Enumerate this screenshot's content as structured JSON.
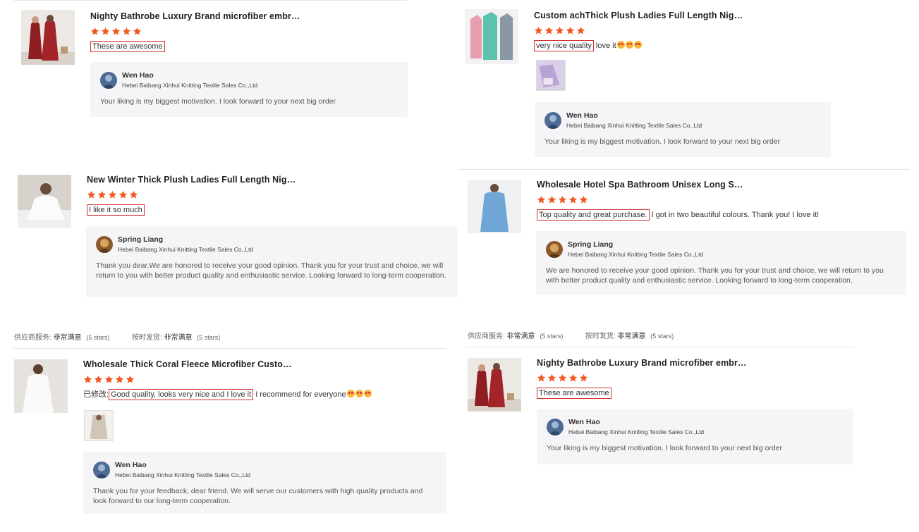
{
  "colors": {
    "star": "#f2571f",
    "highlight_border": "#d0312d",
    "reply_bg": "#f5f5f7"
  },
  "icons": {
    "rating": "star-icon",
    "avatar_wen": "avatar-blue-icon",
    "avatar_spring": "avatar-brown-icon"
  },
  "reviews": [
    {
      "title": "Nighty Bathrobe Luxury Brand microfiber embr…",
      "rating": 5,
      "comment_prefix": "",
      "comment_highlight": "These are awesome",
      "comment_rest": "",
      "emoji_count": 0,
      "reply": {
        "name": "Wen Hao",
        "company": "Hebei Baibang Xinhui Knitting Textile Sales Co.,Ltd",
        "text": "Your liking is my biggest motivation. I look forward to your next big order"
      }
    },
    {
      "title": "Custom achThick Plush Ladies Full Length Nig…",
      "rating": 5,
      "comment_prefix": "",
      "comment_highlight": "very nice quality",
      "comment_rest": " love it",
      "emoji_count": 3,
      "reply": {
        "name": "Wen Hao",
        "company": "Hebei Baibang Xinhui Knitting Textile Sales Co.,Ltd",
        "text": "Your liking is my biggest motivation. I look forward to your next big order"
      }
    },
    {
      "title": "New Winter Thick Plush Ladies Full Length Nig…",
      "rating": 5,
      "comment_prefix": "",
      "comment_highlight": "I like it so much",
      "comment_rest": "",
      "emoji_count": 0,
      "reply": {
        "name": "Spring Liang",
        "company": "Hebei Baibang Xinhui Knitting Textile Sales Co.,Ltd",
        "text": "Thank you dear.We are honored to receive your good opinion. Thank you for your trust and choice, we will return to you with better product quality and enthusiastic service. Looking forward to long-term cooperation."
      }
    },
    {
      "title": "Wholesale Hotel Spa Bathroom Unisex Long S…",
      "rating": 5,
      "comment_prefix": "",
      "comment_highlight": "Top quality and great purchase.",
      "comment_rest": " I got in two beautiful colours. Thank you! I love it!",
      "emoji_count": 0,
      "reply": {
        "name": "Spring Liang",
        "company": "Hebei Baibang Xinhui Knitting Textile Sales Co.,Ltd",
        "text": "We are honored to receive your good opinion. Thank you for your trust and choice, we will return to you with better product quality and enthusiastic service. Looking forward to long-term cooperation."
      }
    },
    {
      "title": "Wholesale Thick Coral Fleece Microfiber Custo…",
      "rating": 5,
      "comment_prefix": "已修改:",
      "comment_highlight": "Good quality, looks very nice and I love it",
      "comment_rest": " I recommend for everyone",
      "emoji_count": 3,
      "reply": {
        "name": "Wen Hao",
        "company": "Hebei Baibang Xinhui Knitting Textile Sales Co.,Ltd",
        "text": "Thank you for your feedback, dear friend. We will serve our customers with high quality products and look forward to our long-term cooperation."
      }
    },
    {
      "title": "Nighty Bathrobe Luxury Brand microfiber embr…",
      "rating": 5,
      "comment_prefix": "",
      "comment_highlight": "These are awesome",
      "comment_rest": "",
      "emoji_count": 0,
      "reply": {
        "name": "Wen Hao",
        "company": "Hebei Baibang Xinhui Knitting Textile Sales Co.,Ltd",
        "text": "Your liking is my biggest motivation. I look forward to your next big order"
      }
    }
  ],
  "service_rows": [
    {
      "label1": "供应商服务:",
      "value1": "非常满意",
      "stars1": "(5 stars)",
      "label2": "按时发货:",
      "value2": "非常满意",
      "stars2": "(5 stars)"
    },
    {
      "label1": "供应商服务:",
      "value1": "非常满意",
      "stars1": "(5 stars)",
      "label2": "按时发货:",
      "value2": "非常满意",
      "stars2": "(5 stars)"
    }
  ]
}
